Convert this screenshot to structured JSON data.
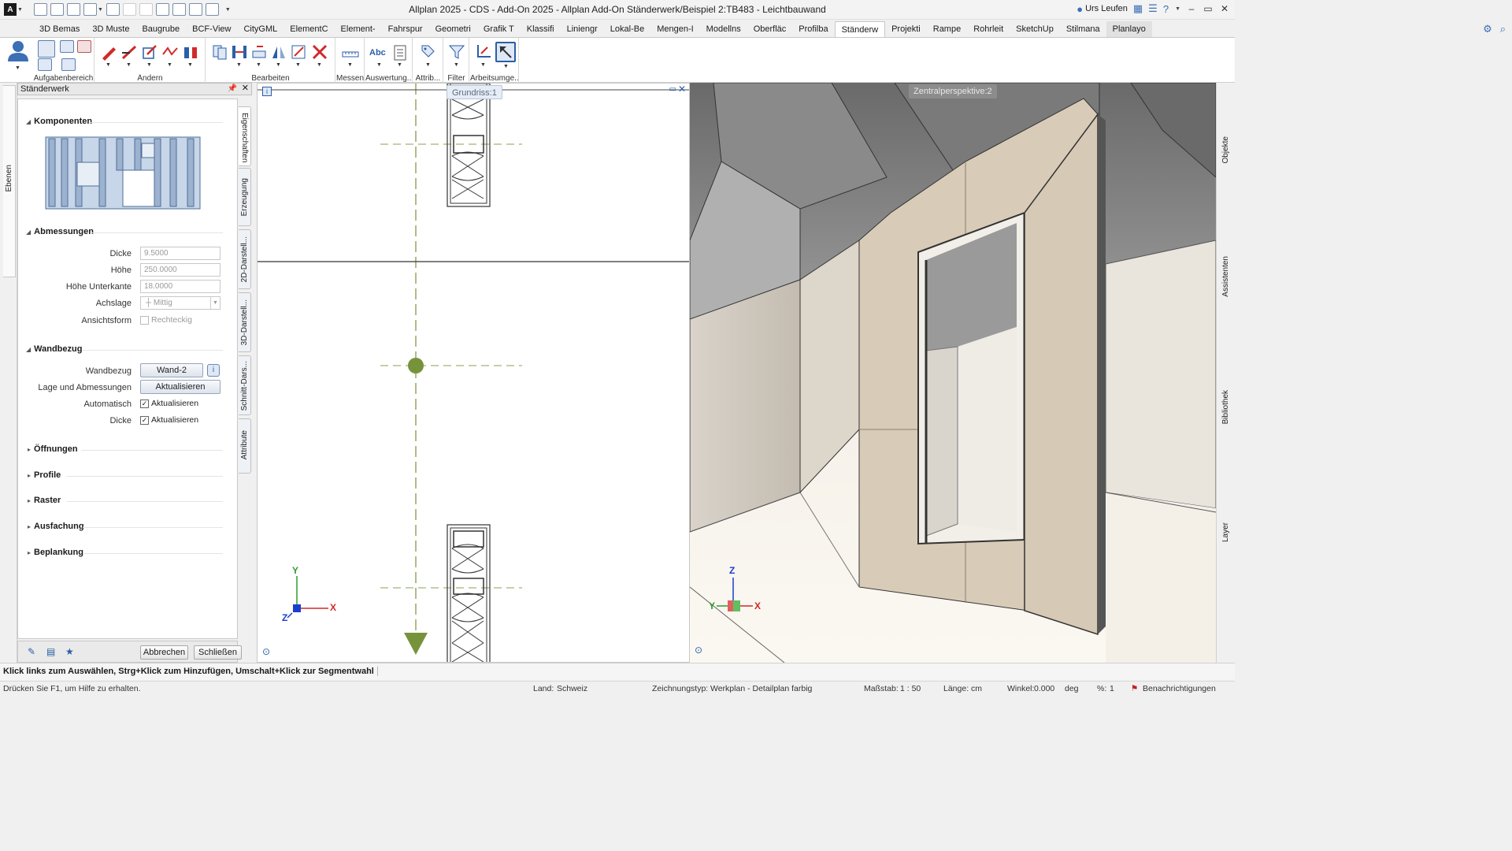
{
  "window": {
    "title": "Allplan 2025 - CDS - Add-On 2025 - Allplan Add-On Ständerwerk/Beispiel 2:TB483 - Leichtbauwand",
    "user": "Urs Leufen"
  },
  "ribbon_tabs": [
    "3D Bemas",
    "3D Muste",
    "Baugrube",
    "BCF-View",
    "CityGML",
    "ElementC",
    "Element-",
    "Fahrspur",
    "Geometri",
    "Grafik T",
    "Klassifi",
    "Liniengr",
    "Lokal-Be",
    "Mengen-I",
    "Modellns",
    "Oberfläc",
    "Profilba",
    "Ständerw",
    "Projekti",
    "Rampe",
    "Rohrleit",
    "SketchUp",
    "Stilmana",
    "Planlayo"
  ],
  "ribbon_groups": {
    "aufgabenbereich": "Aufgabenbereich",
    "aendern": "Ändern",
    "bearbeiten": "Bearbeiten",
    "messen": "Messen",
    "auswertung": "Auswertung...",
    "attrib": "Attrib...",
    "filter": "Filter",
    "arbeitsumgebung": "Arbeitsumge..."
  },
  "left_strip": {
    "ebenen": "Ebenen"
  },
  "palette": {
    "title": "Ständerwerk",
    "sections": {
      "komponenten": "Komponenten",
      "abmessungen": "Abmessungen",
      "wandbezug": "Wandbezug",
      "oeffnungen": "Öffnungen",
      "profile": "Profile",
      "raster": "Raster",
      "ausfachung": "Ausfachung",
      "beplankung": "Beplankung"
    },
    "abmessungen": {
      "dicke_label": "Dicke",
      "dicke_value": "9.5000",
      "hoehe_label": "Höhe",
      "hoehe_value": "250.0000",
      "hoehe_unterkante_label": "Höhe Unterkante",
      "hoehe_unterkante_value": "18.0000",
      "achslage_label": "Achslage",
      "achslage_value": "Mittig",
      "ansichtsform_label": "Ansichtsform",
      "ansichtsform_value": "Rechteckig"
    },
    "wandbezug": {
      "wandbezug_label": "Wandbezug",
      "wandbezug_value": "Wand-2",
      "lage_label": "Lage und Abmessungen",
      "lage_button": "Aktualisieren",
      "automatisch_label": "Automatisch",
      "automatisch_check": "Aktualisieren",
      "dicke_label": "Dicke",
      "dicke_check": "Aktualisieren"
    },
    "footer": {
      "cancel": "Abbrechen",
      "close": "Schließen"
    },
    "vtabs": [
      "Eigenschaften",
      "Erzeugung",
      "2D-Darstell...",
      "3D-Darstell...",
      "Schnitt-Dars...",
      "Attribute"
    ]
  },
  "viewports": {
    "plan_label": "Grundriss:1",
    "persp_label": "Zentralperspektive:2",
    "axis_x": "X",
    "axis_y": "Y",
    "axis_z": "Z"
  },
  "right_strip": [
    "Objekte",
    "Assistenten",
    "Bibliothek",
    "Layer"
  ],
  "status": {
    "hint": "Klick links zum Auswählen, Strg+Klick zum Hinzufügen, Umschalt+Klick zur Segmentwahl",
    "help": "Drücken Sie F1, um Hilfe zu erhalten.",
    "land_label": "Land:",
    "land_value": "Schweiz",
    "zeichnungstyp_label": "Zeichnungstyp:",
    "zeichnungstyp_value": "Werkplan - Detailplan farbig",
    "massstab_label": "Maßstab:",
    "massstab_value": "1 : 50",
    "laenge_label": "Länge:",
    "laenge_value": "cm",
    "winkel_label": "Winkel:",
    "winkel_value": "0.000",
    "winkel_unit": "deg",
    "percent_label": "%:",
    "percent_value": "1",
    "notifications": "Benachrichtigungen"
  },
  "colors": {
    "accent": "#3c6fb5",
    "plan_green": "#76933c",
    "wall_beige": "#d8cbb8"
  }
}
